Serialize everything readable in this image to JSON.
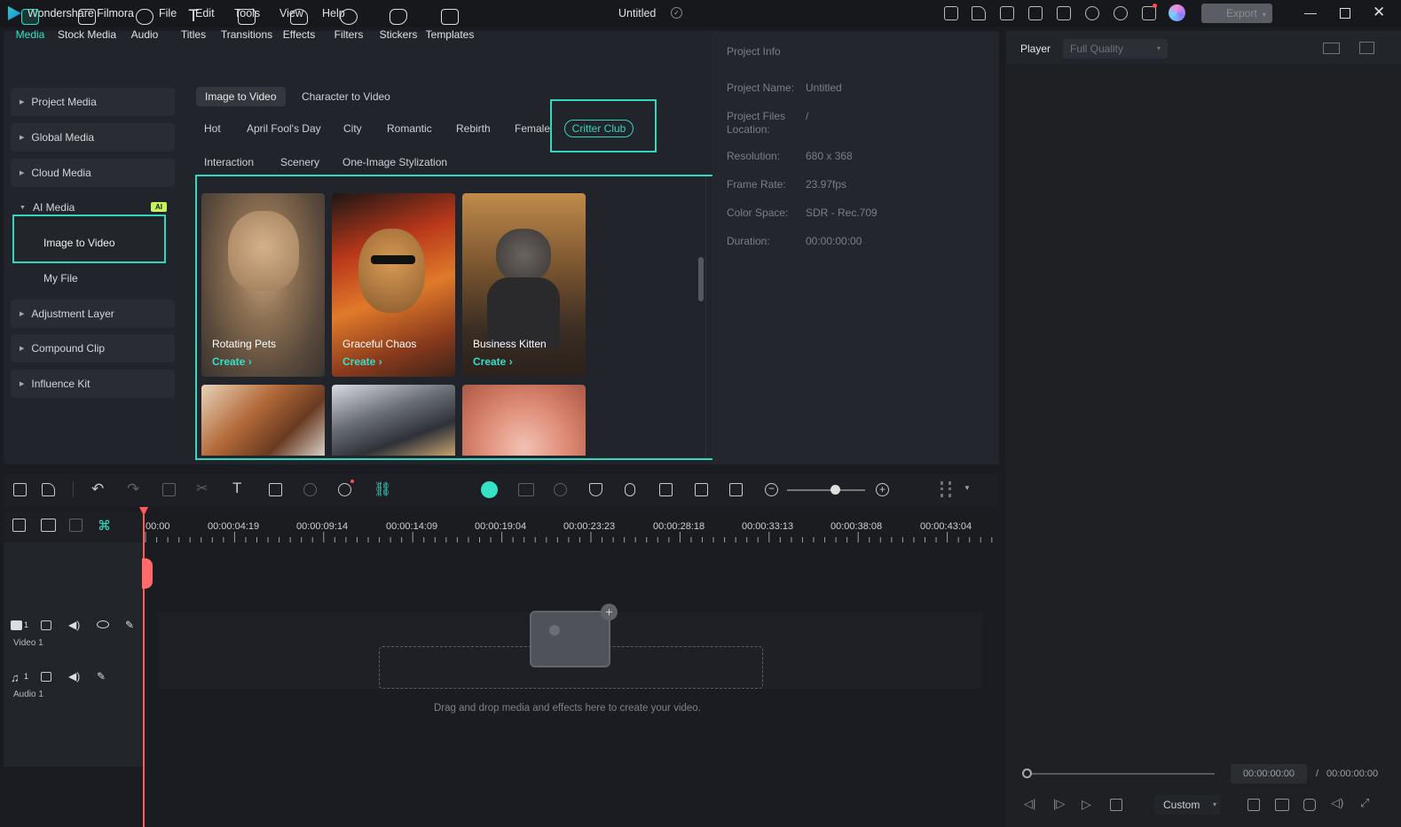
{
  "app": {
    "name": "Wondershare Filmora",
    "doc_title": "Untitled"
  },
  "menu": [
    "File",
    "Edit",
    "Tools",
    "View",
    "Help"
  ],
  "export_label": "Export",
  "top_tabs": [
    "Media",
    "Stock Media",
    "Audio",
    "Titles",
    "Transitions",
    "Effects",
    "Filters",
    "Stickers",
    "Templates"
  ],
  "sidebar": {
    "items": [
      "Project Media",
      "Global Media",
      "Cloud Media",
      "AI Media",
      "Adjustment Layer",
      "Compound Clip",
      "Influence Kit"
    ],
    "ai_badge": "AI",
    "sub_items": [
      "Image to Video",
      "My File"
    ]
  },
  "mode_tabs": [
    "Image to Video",
    "Character to Video"
  ],
  "categories": [
    "Hot",
    "April Fool's Day",
    "City",
    "Romantic",
    "Rebirth",
    "Female",
    "Critter Club",
    "Interaction",
    "Scenery",
    "One-Image Stylization"
  ],
  "cards": [
    {
      "title": "Rotating Pets",
      "action": "Create"
    },
    {
      "title": "Graceful Chaos",
      "action": "Create"
    },
    {
      "title": "Business Kitten",
      "action": "Create"
    }
  ],
  "project_info": {
    "title": "Project Info",
    "rows": [
      {
        "k": "Project Name:",
        "v": "Untitled"
      },
      {
        "k": "Project Files Location:",
        "v": "/"
      },
      {
        "k": "Resolution:",
        "v": "680 x 368"
      },
      {
        "k": "Frame Rate:",
        "v": "23.97fps"
      },
      {
        "k": "Color Space:",
        "v": "SDR - Rec.709"
      },
      {
        "k": "Duration:",
        "v": "00:00:00:00"
      }
    ]
  },
  "player": {
    "label": "Player",
    "quality": "Full Quality",
    "time_current": "00:00:00:00",
    "time_sep": "/",
    "time_total": "00:00:00:00",
    "ratio": "Custom"
  },
  "timeline": {
    "ticks": [
      "00:00",
      "00:00:04:19",
      "00:00:09:14",
      "00:00:14:09",
      "00:00:19:04",
      "00:00:23:23",
      "00:00:28:18",
      "00:00:33:13",
      "00:00:38:08",
      "00:00:43:04"
    ],
    "tracks": [
      {
        "num": "1",
        "name": "Video 1"
      },
      {
        "num": "1",
        "name": "Audio 1"
      }
    ],
    "drop_hint": "Drag and drop media and effects here to create your video."
  },
  "colors": {
    "accent": "#34d6bd",
    "playhead": "#ff5a5a",
    "ai_badge": "#c7f25a"
  }
}
